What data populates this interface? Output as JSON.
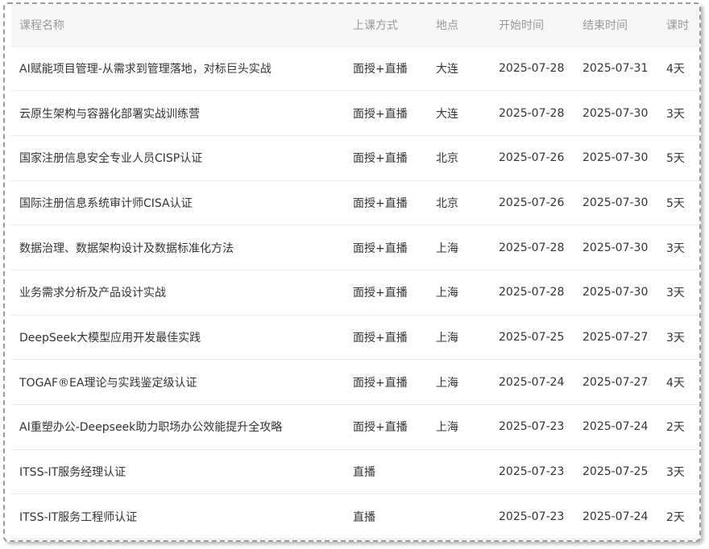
{
  "table": {
    "headers": {
      "name": "课程名称",
      "mode": "上课方式",
      "location": "地点",
      "start": "开始时间",
      "end": "结束时间",
      "days": "课时"
    },
    "rows": [
      {
        "name": "AI赋能项目管理-从需求到管理落地，对标巨头实战",
        "mode": "面授+直播",
        "location": "大连",
        "start": "2025-07-28",
        "end": "2025-07-31",
        "days": "4天"
      },
      {
        "name": "云原生架构与容器化部署实战训练营",
        "mode": "面授+直播",
        "location": "大连",
        "start": "2025-07-28",
        "end": "2025-07-30",
        "days": "3天"
      },
      {
        "name": "国家注册信息安全专业人员CISP认证",
        "mode": "面授+直播",
        "location": "北京",
        "start": "2025-07-26",
        "end": "2025-07-30",
        "days": "5天"
      },
      {
        "name": "国际注册信息系统审计师CISA认证",
        "mode": "面授+直播",
        "location": "北京",
        "start": "2025-07-26",
        "end": "2025-07-30",
        "days": "5天"
      },
      {
        "name": "数据治理、数据架构设计及数据标准化方法",
        "mode": "面授+直播",
        "location": "上海",
        "start": "2025-07-28",
        "end": "2025-07-30",
        "days": "3天"
      },
      {
        "name": "业务需求分析及产品设计实战",
        "mode": "面授+直播",
        "location": "上海",
        "start": "2025-07-28",
        "end": "2025-07-30",
        "days": "3天"
      },
      {
        "name": "DeepSeek大模型应用开发最佳实践",
        "mode": "面授+直播",
        "location": "上海",
        "start": "2025-07-25",
        "end": "2025-07-27",
        "days": "3天"
      },
      {
        "name": "TOGAF®EA理论与实践鉴定级认证",
        "mode": "面授+直播",
        "location": "上海",
        "start": "2025-07-24",
        "end": "2025-07-27",
        "days": "4天"
      },
      {
        "name": "AI重塑办公-Deepseek助力职场办公效能提升全攻略",
        "mode": "面授+直播",
        "location": "上海",
        "start": "2025-07-23",
        "end": "2025-07-24",
        "days": "2天"
      },
      {
        "name": "ITSS-IT服务经理认证",
        "mode": "直播",
        "location": "",
        "start": "2025-07-23",
        "end": "2025-07-25",
        "days": "3天"
      },
      {
        "name": "ITSS-IT服务工程师认证",
        "mode": "直播",
        "location": "",
        "start": "2025-07-23",
        "end": "2025-07-24",
        "days": "2天"
      }
    ]
  }
}
